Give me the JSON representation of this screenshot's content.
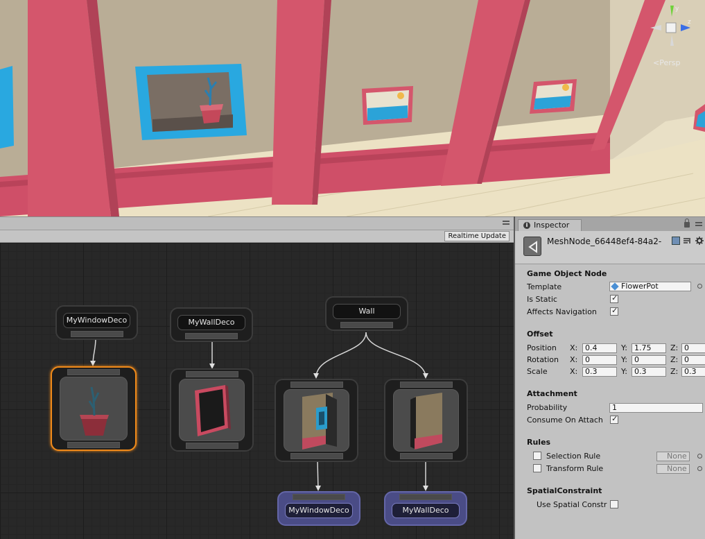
{
  "scene": {
    "persp_label": "Persp",
    "gizmo_axes": {
      "x": "x",
      "y": "y",
      "z": "z"
    }
  },
  "graph": {
    "realtime_button": "Realtime Update",
    "nodes": {
      "my_window_deco_label": "MyWindowDeco",
      "my_wall_deco_label": "MyWallDeco",
      "wall_label": "Wall",
      "bottom_window_deco_label": "MyWindowDeco",
      "bottom_wall_deco_label": "MyWallDeco"
    }
  },
  "inspector": {
    "tab_label": "Inspector",
    "object_name": "MeshNode_66448ef4-84a2-",
    "game_object_node": {
      "title": "Game Object Node",
      "template_label": "Template",
      "template_value": "FlowerPot",
      "is_static_label": "Is Static",
      "is_static": true,
      "affects_navigation_label": "Affects Navigation",
      "affects_navigation": true
    },
    "offset": {
      "title": "Offset",
      "position_label": "Position",
      "position": {
        "x": "0.4",
        "y": "1.75",
        "z": "0"
      },
      "rotation_label": "Rotation",
      "rotation": {
        "x": "0",
        "y": "0",
        "z": "0"
      },
      "scale_label": "Scale",
      "scale": {
        "x": "0.3",
        "y": "0.3",
        "z": "0.3"
      },
      "axis_x": "X:",
      "axis_y": "Y:",
      "axis_z": "Z:"
    },
    "attachment": {
      "title": "Attachment",
      "probability_label": "Probability",
      "probability_value": "1",
      "consume_label": "Consume On Attach",
      "consume": true
    },
    "rules": {
      "title": "Rules",
      "selection_rule_label": "Selection Rule",
      "selection_rule_value": "None",
      "transform_rule_label": "Transform Rule",
      "transform_rule_value": "None"
    },
    "spatial": {
      "title": "SpatialConstraint",
      "use_label": "Use Spatial Constr"
    }
  },
  "colors": {
    "wall_pink": "#d4566c",
    "wall_beige": "#b9ad96",
    "frame_blue": "#29a8e0",
    "selected_orange": "#f08a1a",
    "leaf_node_purple": "#4a4c86"
  }
}
